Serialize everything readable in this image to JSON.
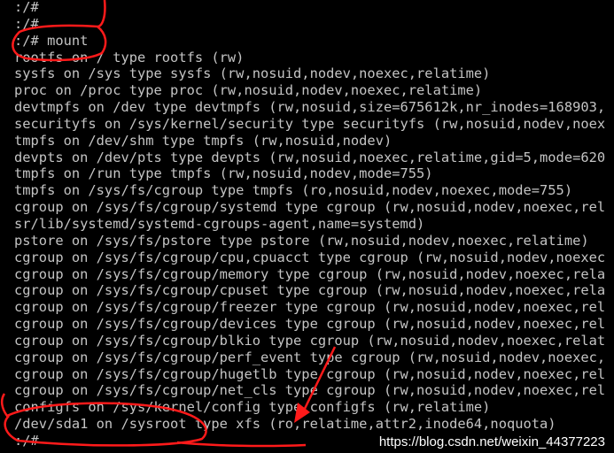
{
  "terminal": {
    "lines": [
      ":/#",
      ":/#",
      ":/# mount",
      "rootfs on / type rootfs (rw)",
      "sysfs on /sys type sysfs (rw,nosuid,nodev,noexec,relatime)",
      "proc on /proc type proc (rw,nosuid,nodev,noexec,relatime)",
      "devtmpfs on /dev type devtmpfs (rw,nosuid,size=675612k,nr_inodes=168903,",
      "securityfs on /sys/kernel/security type securityfs (rw,nosuid,nodev,noex",
      "tmpfs on /dev/shm type tmpfs (rw,nosuid,nodev)",
      "devpts on /dev/pts type devpts (rw,nosuid,noexec,relatime,gid=5,mode=620",
      "tmpfs on /run type tmpfs (rw,nosuid,nodev,mode=755)",
      "tmpfs on /sys/fs/cgroup type tmpfs (ro,nosuid,nodev,noexec,mode=755)",
      "cgroup on /sys/fs/cgroup/systemd type cgroup (rw,nosuid,nodev,noexec,rel",
      "sr/lib/systemd/systemd-cgroups-agent,name=systemd)",
      "pstore on /sys/fs/pstore type pstore (rw,nosuid,nodev,noexec,relatime)",
      "cgroup on /sys/fs/cgroup/cpu,cpuacct type cgroup (rw,nosuid,nodev,noexec",
      "cgroup on /sys/fs/cgroup/memory type cgroup (rw,nosuid,nodev,noexec,rela",
      "cgroup on /sys/fs/cgroup/cpuset type cgroup (rw,nosuid,nodev,noexec,rela",
      "cgroup on /sys/fs/cgroup/freezer type cgroup (rw,nosuid,nodev,noexec,rel",
      "cgroup on /sys/fs/cgroup/devices type cgroup (rw,nosuid,nodev,noexec,rel",
      "cgroup on /sys/fs/cgroup/blkio type cgroup (rw,nosuid,nodev,noexec,relat",
      "cgroup on /sys/fs/cgroup/perf_event type cgroup (rw,nosuid,nodev,noexec,",
      "cgroup on /sys/fs/cgroup/hugetlb type cgroup (rw,nosuid,nodev,noexec,rel",
      "cgroup on /sys/fs/cgroup/net_cls type cgroup (rw,nosuid,nodev,noexec,rel",
      "configfs on /sys/kernel/config type configfs (rw,relatime)",
      "/dev/sda1 on /sysroot type xfs (ro,relatime,attr2,inode64,noquota)",
      ":/#"
    ]
  },
  "watermark": "https://blog.csdn.net/weixin_44377223",
  "colors": {
    "text": "#c4c4c4",
    "background": "#000000",
    "annotation": "#ff1a1a"
  }
}
